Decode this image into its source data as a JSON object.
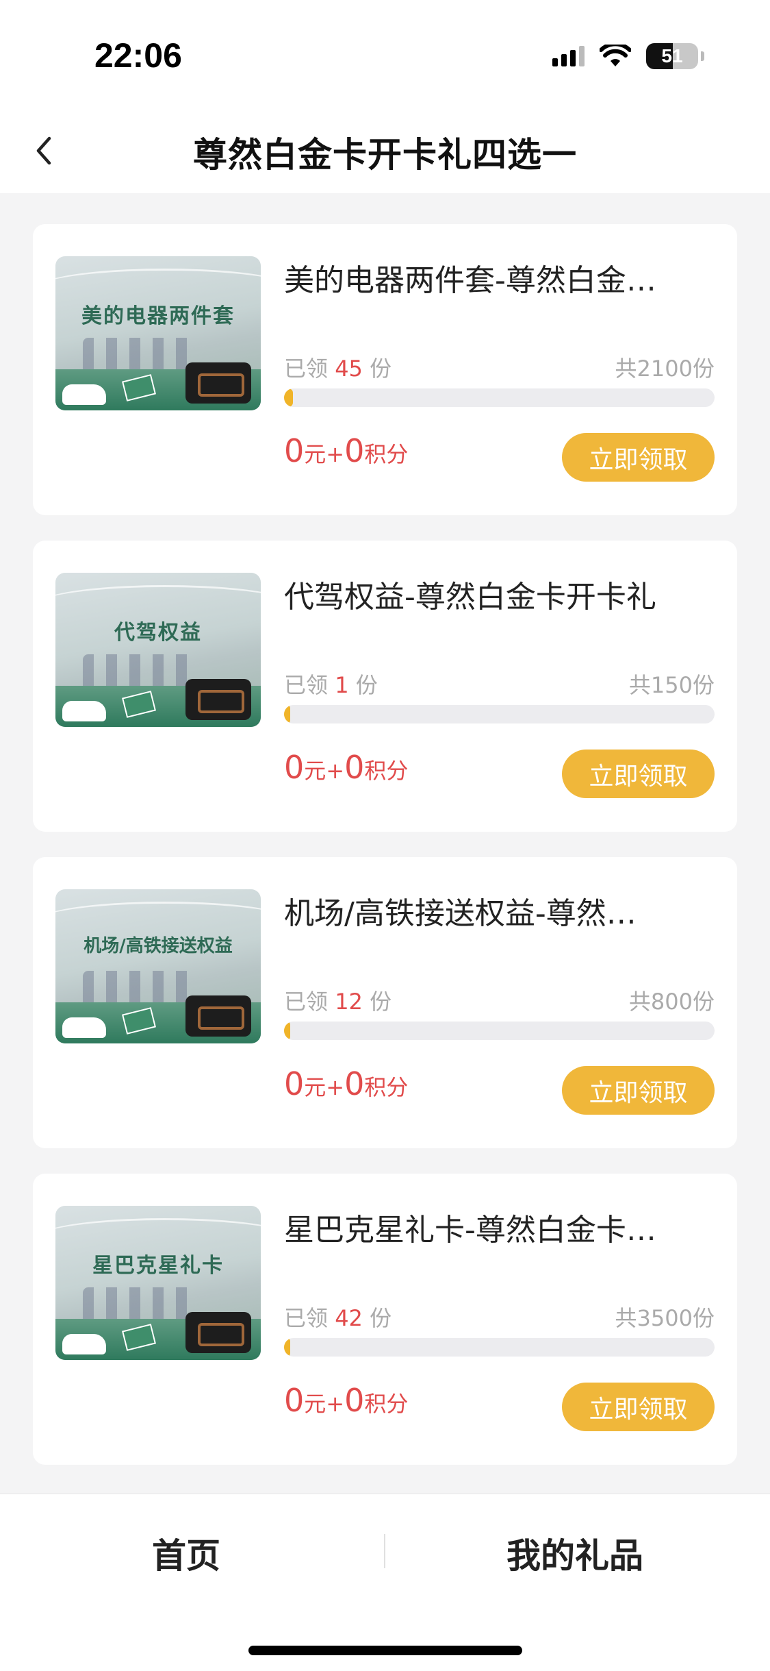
{
  "status_bar": {
    "time": "22:06",
    "battery": "51",
    "battery_level": 0.51
  },
  "header": {
    "title": "尊然白金卡开卡礼四选一"
  },
  "cards": [
    {
      "thumb_text": "美的电器两件套",
      "title": "美的电器两件套-尊然白金…",
      "claimed_label": "已领",
      "claimed": "45",
      "unit": "份",
      "total": "共2100份",
      "progress": 0.021,
      "price_amount": "0",
      "price_yuan": "元+",
      "price_points": "0",
      "price_points_label": "积分",
      "button": "立即领取"
    },
    {
      "thumb_text": "代驾权益",
      "title": "代驾权益-尊然白金卡开卡礼",
      "claimed_label": "已领",
      "claimed": "1",
      "unit": "份",
      "total": "共150份",
      "progress": 0.0067,
      "price_amount": "0",
      "price_yuan": "元+",
      "price_points": "0",
      "price_points_label": "积分",
      "button": "立即领取"
    },
    {
      "thumb_text": "机场/高铁接送权益",
      "title": "机场/高铁接送权益-尊然…",
      "claimed_label": "已领",
      "claimed": "12",
      "unit": "份",
      "total": "共800份",
      "progress": 0.015,
      "price_amount": "0",
      "price_yuan": "元+",
      "price_points": "0",
      "price_points_label": "积分",
      "button": "立即领取"
    },
    {
      "thumb_text": "星巴克星礼卡",
      "title": "星巴克星礼卡-尊然白金卡…",
      "claimed_label": "已领",
      "claimed": "42",
      "unit": "份",
      "total": "共3500份",
      "progress": 0.012,
      "price_amount": "0",
      "price_yuan": "元+",
      "price_points": "0",
      "price_points_label": "积分",
      "button": "立即领取"
    }
  ],
  "bottom_nav": {
    "home": "首页",
    "gifts": "我的礼品"
  },
  "colors": {
    "accent": "#f0b73a",
    "price": "#e14b4b",
    "progress": "#f0b429"
  }
}
